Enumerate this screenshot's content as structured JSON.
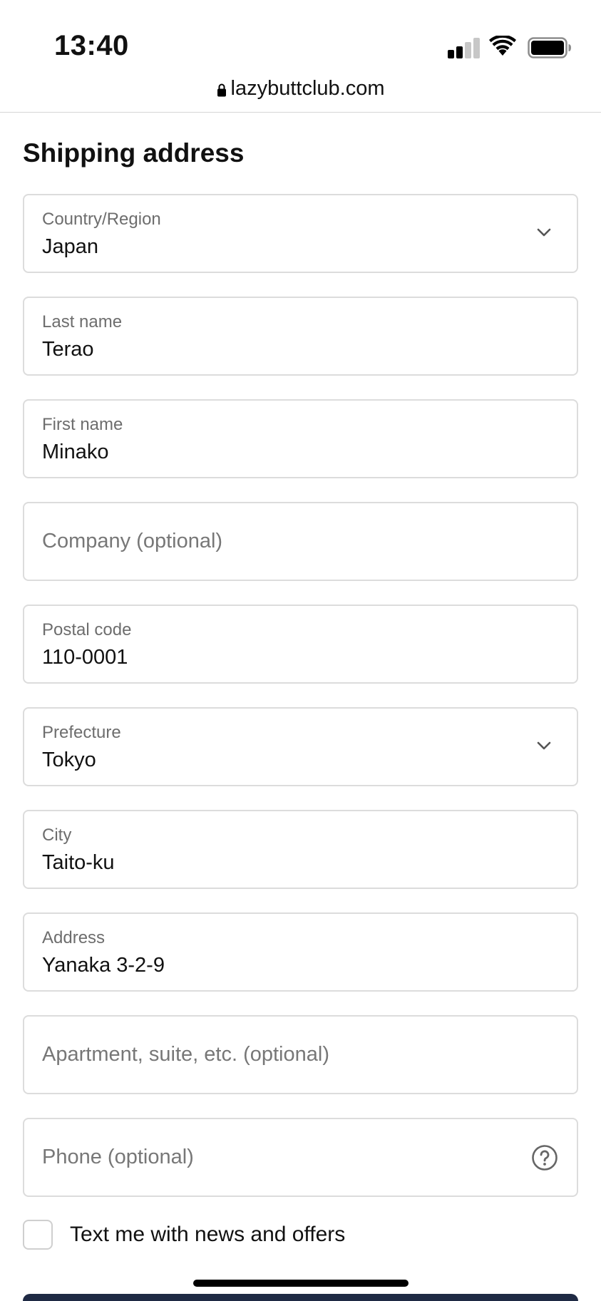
{
  "status_bar": {
    "time": "13:40",
    "signal_icon": "cellular-signal-icon",
    "wifi_icon": "wifi-icon",
    "battery_icon": "battery-icon"
  },
  "browser": {
    "url": "lazybuttclub.com",
    "lock_icon": "lock-icon"
  },
  "form": {
    "title": "Shipping address",
    "fields": [
      {
        "label": "Country/Region",
        "value": "Japan",
        "type": "select",
        "icon": "chevron-down-icon"
      },
      {
        "label": "Last name",
        "value": "Terao",
        "type": "text"
      },
      {
        "label": "First name",
        "value": "Minako",
        "type": "text"
      },
      {
        "placeholder": "Company (optional)",
        "value": "",
        "type": "text"
      },
      {
        "label": "Postal code",
        "value": "110-0001",
        "type": "text"
      },
      {
        "label": "Prefecture",
        "value": "Tokyo",
        "type": "select",
        "icon": "chevron-down-icon"
      },
      {
        "label": "City",
        "value": "Taito-ku",
        "type": "text"
      },
      {
        "label": "Address",
        "value": "Yanaka 3-2-9",
        "type": "text"
      },
      {
        "placeholder": "Apartment, suite, etc. (optional)",
        "value": "",
        "type": "text"
      },
      {
        "placeholder": "Phone (optional)",
        "value": "",
        "type": "tel",
        "icon": "question-circle-icon"
      }
    ],
    "marketing_checkbox": {
      "label": "Text me with news and offers",
      "checked": false
    }
  },
  "colors": {
    "field_border": "#dcdcdc",
    "label": "#6d6d6d",
    "placeholder": "#777777",
    "button": "#1f2a44"
  }
}
